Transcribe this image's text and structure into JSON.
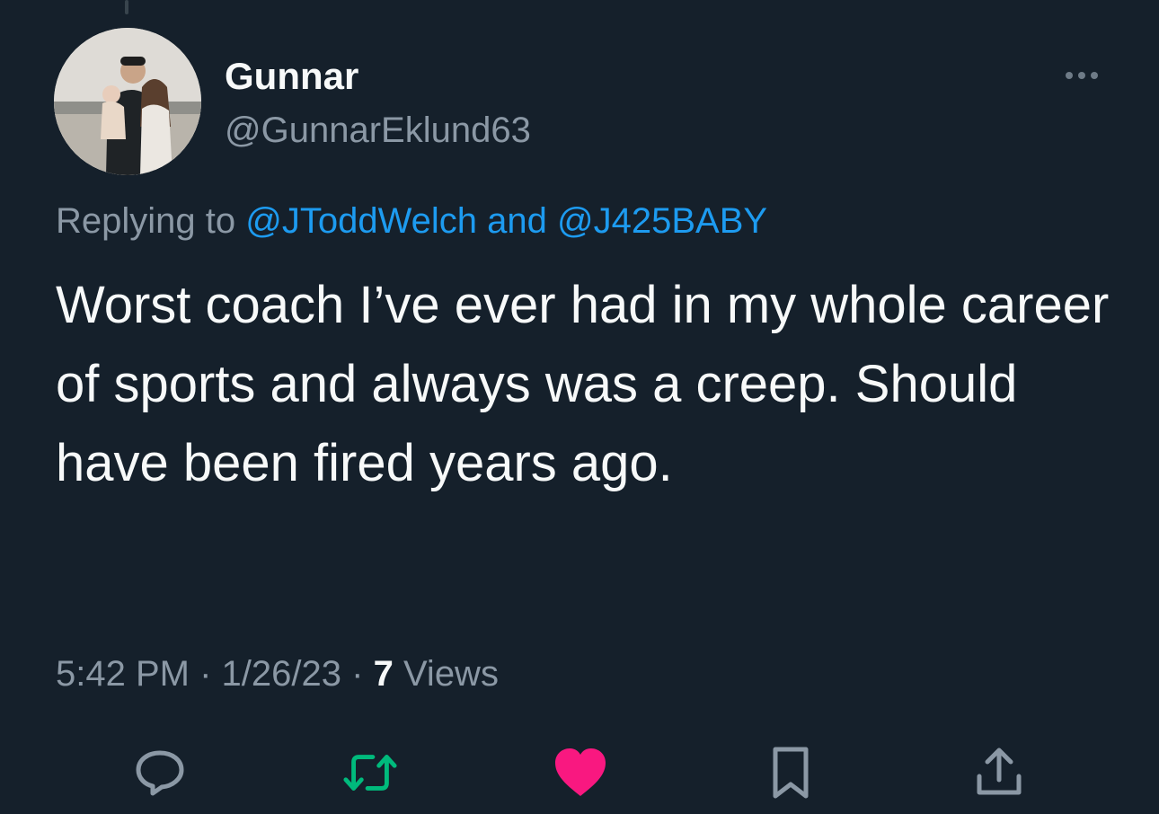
{
  "tweet": {
    "author": {
      "display_name": "Gunnar",
      "handle": "@GunnarEklund63",
      "avatar_icon": "profile-photo"
    },
    "reply_prefix": "Replying to",
    "reply_mention_1": "@JToddWelch",
    "reply_connector": "and",
    "reply_mention_2": "@J425BABY",
    "text": "Worst coach I’ve ever had in my whole career of sports and always was a creep. Should have been fired years ago.",
    "time": "5:42 PM",
    "separator": "·",
    "date": "1/26/23",
    "views_count": "7",
    "views_label": "Views"
  },
  "actions": [
    {
      "name": "reply",
      "icon": "speech-bubble-icon",
      "color": "#8b98a5"
    },
    {
      "name": "retweet",
      "icon": "retweet-icon",
      "color": "#00ba7c"
    },
    {
      "name": "like",
      "icon": "heart-filled-icon",
      "color": "#f91880"
    },
    {
      "name": "bookmark",
      "icon": "bookmark-icon",
      "color": "#8b98a5"
    },
    {
      "name": "share",
      "icon": "share-upload-icon",
      "color": "#8b98a5"
    }
  ],
  "colors": {
    "background": "#15202b",
    "primary_text": "#f7f9f9",
    "secondary_text": "#8b98a5",
    "link": "#1d9bf0",
    "retweet": "#00ba7c",
    "like": "#f91880"
  }
}
